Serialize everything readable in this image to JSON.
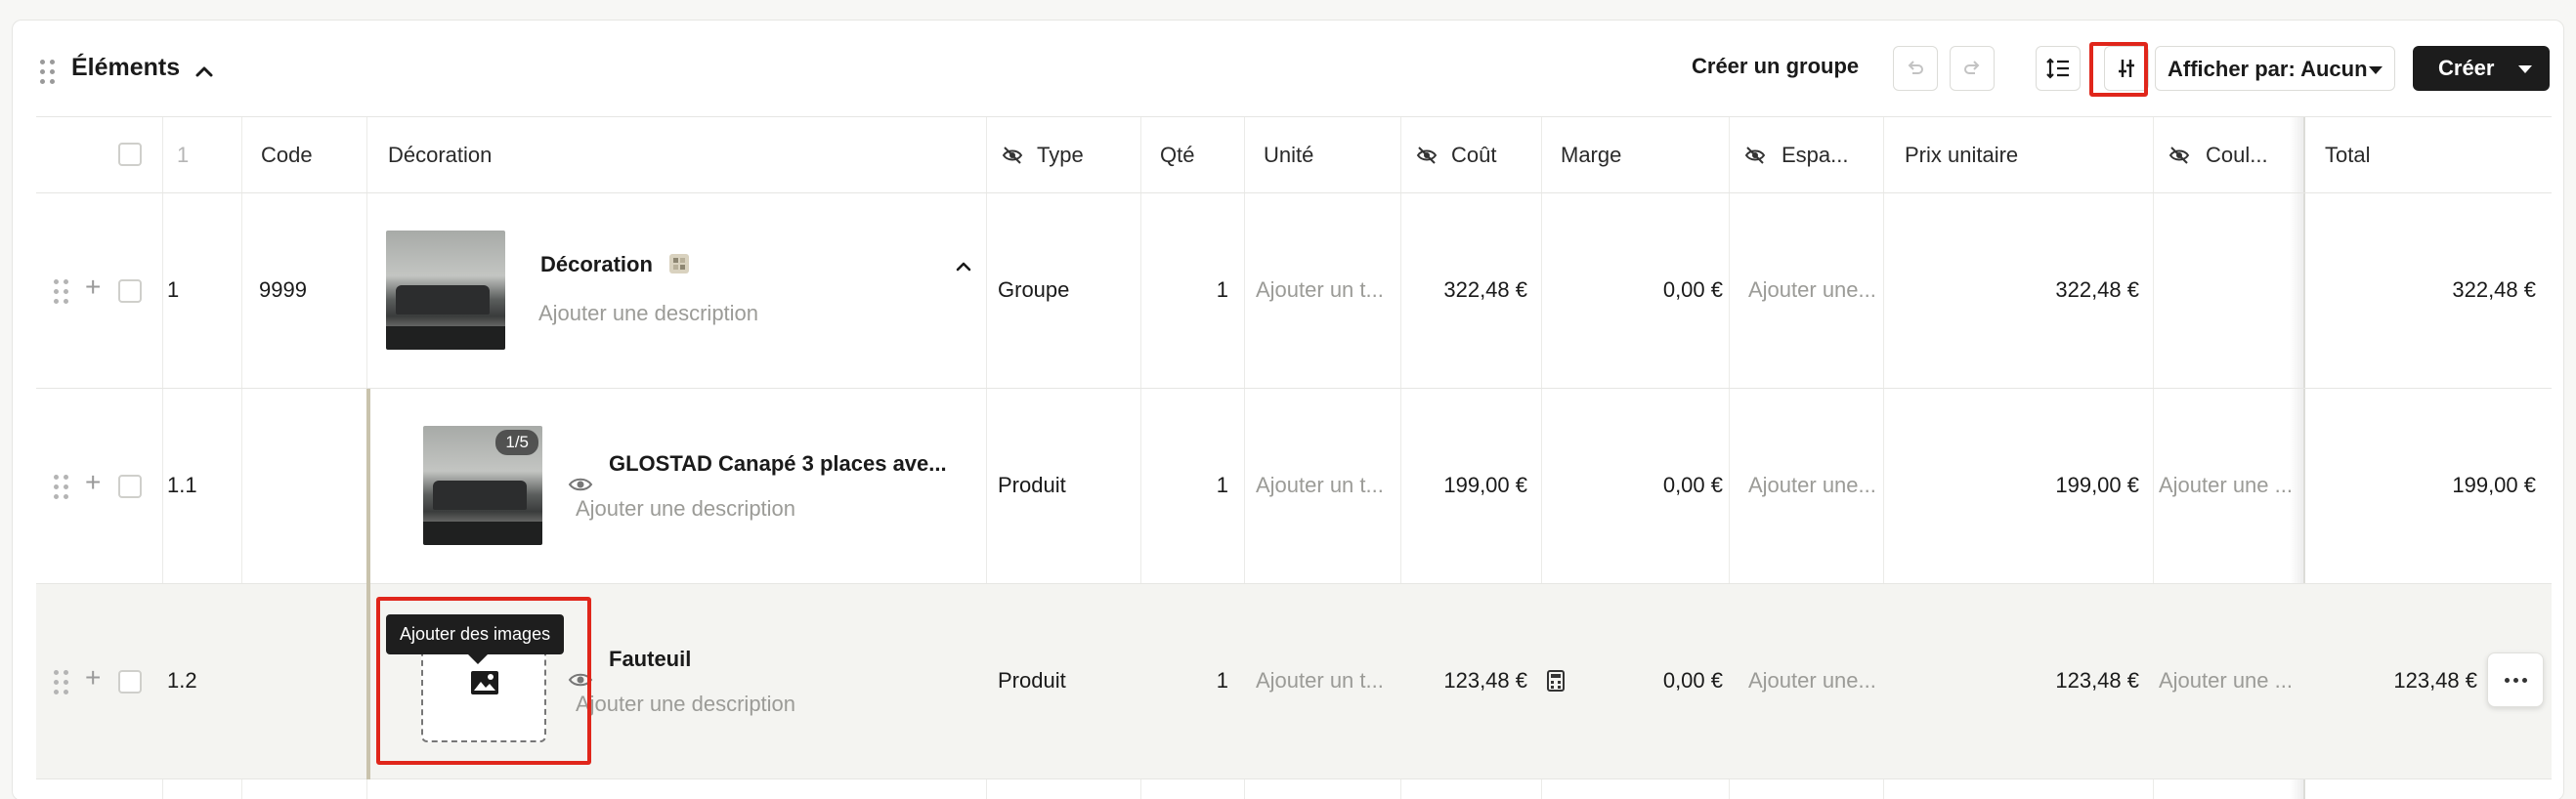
{
  "header": {
    "title": "Éléments",
    "create_group_label": "Créer un groupe",
    "display_by_label": "Afficher par: Aucun",
    "create_label": "Créer"
  },
  "columns": {
    "index": "1",
    "code": "Code",
    "decoration": "Décoration",
    "type": "Type",
    "qty": "Qté",
    "unit": "Unité",
    "cost": "Coût",
    "margin": "Marge",
    "space": "Espa...",
    "unit_price": "Prix unitaire",
    "color": "Coul...",
    "total": "Total"
  },
  "rows": [
    {
      "index": "1",
      "code": "9999",
      "name": "Décoration",
      "description_placeholder": "Ajouter une description",
      "type": "Groupe",
      "qty": "1",
      "unit_placeholder": "Ajouter un t...",
      "cost": "322,48 €",
      "margin": "0,00 €",
      "space_placeholder": "Ajouter une...",
      "unit_price": "322,48 €",
      "color_placeholder": "",
      "total": "322,48 €"
    },
    {
      "index": "1.1",
      "code": "",
      "image_badge": "1/5",
      "name": "GLOSTAD Canapé 3 places ave...",
      "description_placeholder": "Ajouter une description",
      "type": "Produit",
      "qty": "1",
      "unit_placeholder": "Ajouter un t...",
      "cost": "199,00 €",
      "margin": "0,00 €",
      "space_placeholder": "Ajouter une...",
      "unit_price": "199,00 €",
      "color_placeholder": "Ajouter une ...",
      "total": "199,00 €"
    },
    {
      "index": "1.2",
      "code": "",
      "name": "Fauteuil",
      "description_placeholder": "Ajouter une description",
      "type": "Produit",
      "qty": "1",
      "unit_placeholder": "Ajouter un t...",
      "cost": "123,48 €",
      "margin": "0,00 €",
      "space_placeholder": "Ajouter une...",
      "unit_price": "123,48 €",
      "color_placeholder": "Ajouter une ...",
      "total": "123,48 €",
      "tooltip": "Ajouter des images"
    }
  ],
  "icons": {
    "drag": "drag-handle-icon",
    "collapse": "chevron-up-icon",
    "undo": "undo-icon",
    "redo": "redo-icon",
    "line_height": "line-height-icon",
    "column_settings": "column-settings-icon",
    "hidden": "eye-off-icon",
    "visible": "eye-icon",
    "add_image": "image-icon",
    "calculator": "calculator-icon",
    "more": "more-icon"
  },
  "colors": {
    "highlight": "#e0261b",
    "primary_button": "#1c1c1c",
    "selected_row": "#f4f4f1"
  }
}
